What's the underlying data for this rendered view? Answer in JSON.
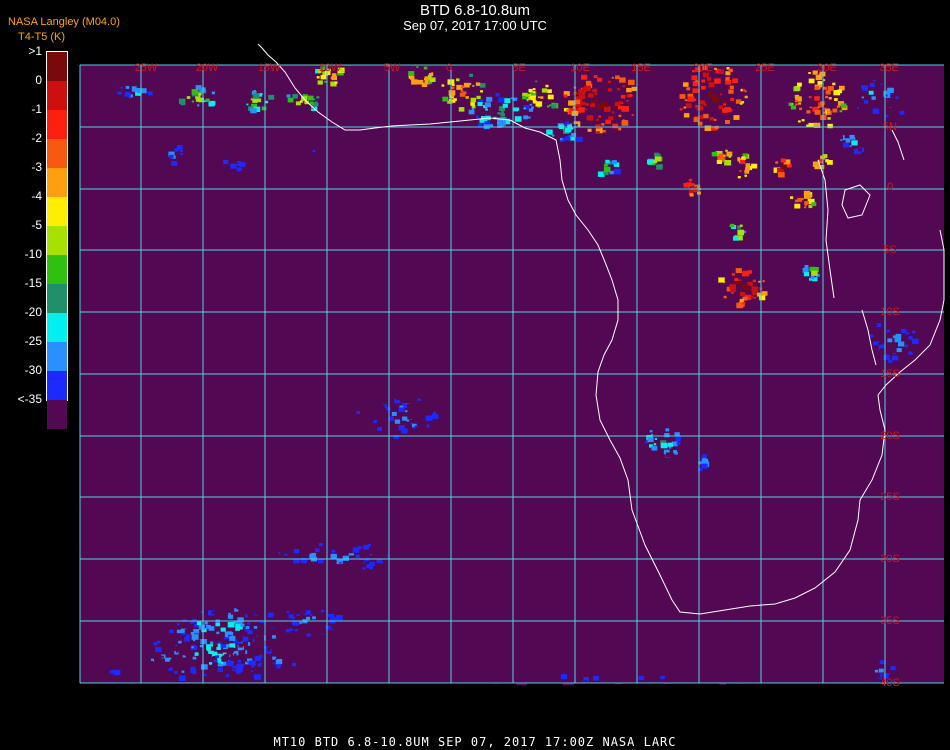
{
  "header": {
    "title": "BTD 6.8-10.8um",
    "subtitle": "Sep 07, 2017 17:00 UTC",
    "credit_line1": "NASA Langley (M04.0)",
    "credit_line2": "T4-T5 (K)"
  },
  "colorbar": {
    "labels": [
      ">1",
      "0",
      "-1",
      "-2",
      "-3",
      "-4",
      "-5",
      "-10",
      "-15",
      "-20",
      "-25",
      "-30",
      "<-35"
    ],
    "colors": [
      "#7a0a0a",
      "#cc1010",
      "#ff1f10",
      "#f55a10",
      "#ff9f10",
      "#ffee00",
      "#a8e000",
      "#2fc010",
      "#20906a",
      "#00f0f0",
      "#2a90ff",
      "#1c2aff",
      "#520852"
    ]
  },
  "map": {
    "background_color": "#520852",
    "grid_color": "#4fd2e6",
    "coast_color": "#ffffff",
    "label_color": "#d01818",
    "lon_labels": [
      "25W",
      "20W",
      "15W",
      "10W",
      "5W",
      "0",
      "5E",
      "10E",
      "15E",
      "20E",
      "25E",
      "30E",
      "35E"
    ],
    "lat_labels": [
      "5N",
      "0",
      "5S",
      "10S",
      "15S",
      "20S",
      "25S",
      "30S",
      "35S",
      "40S"
    ]
  },
  "footer": {
    "text": "MT10  BTD 6.8-10.8UM   SEP 07, 2017 17:00Z   NASA LARC"
  }
}
